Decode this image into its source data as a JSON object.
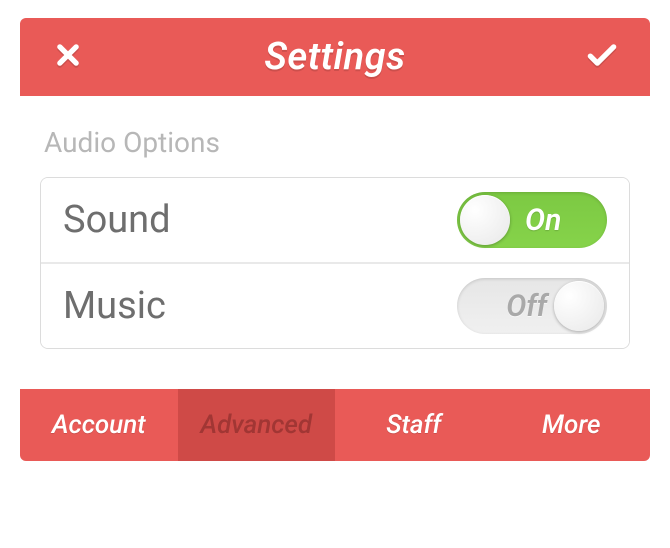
{
  "header": {
    "title": "Settings"
  },
  "section": {
    "title": "Audio Options"
  },
  "options": {
    "sound": {
      "label": "Sound",
      "state_label": "On",
      "on": true
    },
    "music": {
      "label": "Music",
      "state_label": "Off",
      "on": false
    }
  },
  "tabs": {
    "account": "Account",
    "advanced": "Advanced",
    "staff": "Staff",
    "more": "More",
    "active": "advanced"
  }
}
